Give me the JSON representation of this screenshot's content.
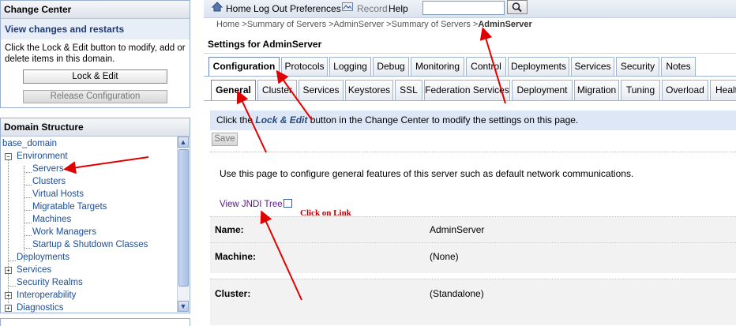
{
  "change_center": {
    "title": "Change Center",
    "subtitle": "View changes and restarts",
    "text": "Click the Lock & Edit button to modify, add or delete items in this domain.",
    "lock_edit": "Lock & Edit",
    "release": "Release Configuration"
  },
  "domain_structure": {
    "title": "Domain Structure",
    "items": [
      {
        "label": "base_domain"
      },
      {
        "label": "Environment"
      },
      {
        "label": "Servers"
      },
      {
        "label": "Clusters"
      },
      {
        "label": "Virtual Hosts"
      },
      {
        "label": "Migratable Targets"
      },
      {
        "label": "Machines"
      },
      {
        "label": "Work Managers"
      },
      {
        "label": "Startup & Shutdown Classes"
      },
      {
        "label": "Deployments"
      },
      {
        "label": "Services"
      },
      {
        "label": "Security Realms"
      },
      {
        "label": "Interoperability"
      },
      {
        "label": "Diagnostics"
      }
    ]
  },
  "nav": {
    "home": "Home",
    "logout": "Log Out",
    "preferences": "Preferences",
    "record": "Record",
    "help": "Help",
    "search_value": ""
  },
  "breadcrumb": {
    "path": "Home >Summary of Servers >AdminServer >Summary of Servers >",
    "current": "AdminServer"
  },
  "settings_title": "Settings for AdminServer",
  "tabs_main": [
    "Configuration",
    "Protocols",
    "Logging",
    "Debug",
    "Monitoring",
    "Control",
    "Deployments",
    "Services",
    "Security",
    "Notes"
  ],
  "tabs_sub": [
    "General",
    "Cluster",
    "Services",
    "Keystores",
    "SSL",
    "Federation Services",
    "Deployment",
    "Migration",
    "Tuning",
    "Overload",
    "Healt"
  ],
  "info": {
    "pre": "Click the ",
    "em": "Lock & Edit",
    "post": " button in the Change Center to modify the settings on this page."
  },
  "save": "Save",
  "description": "Use this page to configure general features of this server such as default network communications.",
  "jndi_link": "View JNDI Tree",
  "callout": "Click on Link",
  "fields": [
    {
      "label": "Name:",
      "value": "AdminServer"
    },
    {
      "label": "Machine:",
      "value": "(None)"
    },
    {
      "label": "Cluster:",
      "value": "(Standalone)"
    }
  ],
  "colors": {
    "annotation_arrow": "#e00000",
    "link": "#1a4d9a",
    "info_bg": "#dde7f6"
  }
}
